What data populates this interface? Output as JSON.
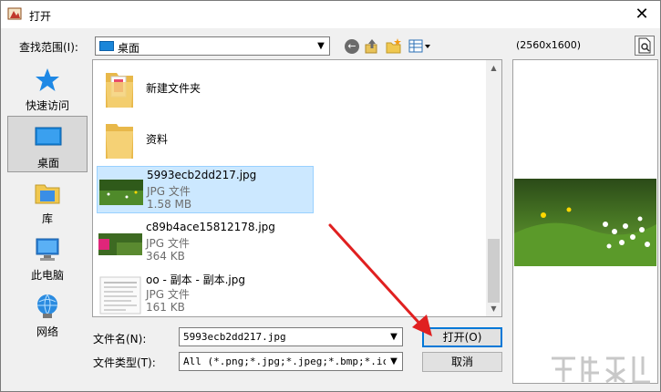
{
  "window": {
    "title": "打开",
    "close_glyph": "✕"
  },
  "toolbar": {
    "lookin_label": "查找范围(I):",
    "lookin_value": "桌面",
    "preview_size": "(2560x1600)"
  },
  "places": [
    {
      "label": "快速访问",
      "icon": "star-icon"
    },
    {
      "label": "桌面",
      "icon": "desktop-icon",
      "selected": true
    },
    {
      "label": "库",
      "icon": "library-icon"
    },
    {
      "label": "此电脑",
      "icon": "computer-icon"
    },
    {
      "label": "网络",
      "icon": "network-icon"
    }
  ],
  "files": [
    {
      "name": "新建文件夹",
      "kind": "folder"
    },
    {
      "name": "资料",
      "kind": "folder"
    },
    {
      "name": "5993ecb2dd217.jpg",
      "type": "JPG 文件",
      "size": "1.58 MB",
      "selected": true
    },
    {
      "name": "c89b4ace15812178.jpg",
      "type": "JPG 文件",
      "size": "364 KB"
    },
    {
      "name": "oo - 副本 - 副本.jpg",
      "type": "JPG 文件",
      "size": "161 KB"
    }
  ],
  "footer": {
    "filename_label": "文件名(N):",
    "filename_value": "5993ecb2dd217.jpg",
    "filetype_label": "文件类型(T):",
    "filetype_value": "All (*.png;*.jpg;*.jpeg;*.bmp;*.ico;*",
    "open_label": "打开(O)",
    "cancel_label": "取消"
  },
  "colors": {
    "selection_bg": "#cce8ff",
    "selection_border": "#99d1ff",
    "default_button_border": "#0078d7",
    "annotation_arrow": "#e02020"
  }
}
